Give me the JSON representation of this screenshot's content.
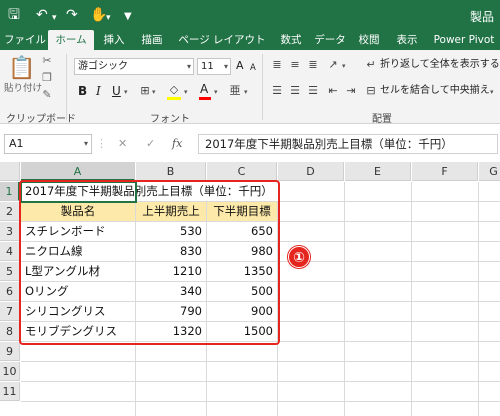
{
  "window": {
    "title": "製品"
  },
  "colors": {
    "accent": "#217346",
    "highlight_red": "#e5261f",
    "header_fill": "#fde9a9"
  },
  "quick_access": {
    "icons": [
      "save-icon",
      "undo-icon",
      "redo-icon",
      "touch-mode-icon",
      "customize-icon"
    ]
  },
  "tabs": [
    {
      "label": "ファイル"
    },
    {
      "label": "ホーム"
    },
    {
      "label": "挿入"
    },
    {
      "label": "描画"
    },
    {
      "label": "ページ レイアウト"
    },
    {
      "label": "数式"
    },
    {
      "label": "データ"
    },
    {
      "label": "校閲"
    },
    {
      "label": "表示"
    },
    {
      "label": "Power Pivot"
    }
  ],
  "ribbon": {
    "clipboard": {
      "paste_label": "貼り付け",
      "group_label": "クリップボード"
    },
    "font": {
      "name": "游ゴシック",
      "size": "11",
      "group_label": "フォント",
      "bold": "B",
      "italic": "I",
      "underline": "U",
      "grow": "A",
      "shrink": "A",
      "font_color": "A"
    },
    "alignment": {
      "wrap_label": "折り返して全体を表示する",
      "merge_label": "セルを結合して中央揃え",
      "group_label": "配置"
    }
  },
  "formula_bar": {
    "name_box": "A1",
    "fx": "fx",
    "formula": "2017年度下半期製品別売上目標（単位：千円）"
  },
  "columns": [
    "A",
    "B",
    "C",
    "D",
    "E",
    "F",
    "G"
  ],
  "rows": [
    "1",
    "2",
    "3",
    "4",
    "5",
    "6",
    "7",
    "8",
    "9",
    "10",
    "11"
  ],
  "sheet": {
    "title": "2017年度下半期製品別売上目標（単位：千円）",
    "headers": [
      "製品名",
      "上半期売上",
      "下半期目標"
    ],
    "data": [
      {
        "name": "スチレンボード",
        "h1": "530",
        "h2": "650"
      },
      {
        "name": "ニクロム線",
        "h1": "830",
        "h2": "980"
      },
      {
        "name": "L型アングル材",
        "h1": "1210",
        "h2": "1350"
      },
      {
        "name": "Oリング",
        "h1": "340",
        "h2": "500"
      },
      {
        "name": "シリコングリス",
        "h1": "790",
        "h2": "900"
      },
      {
        "name": "モリブデングリス",
        "h1": "1320",
        "h2": "1500"
      }
    ]
  },
  "annotation": {
    "badge": "①"
  }
}
